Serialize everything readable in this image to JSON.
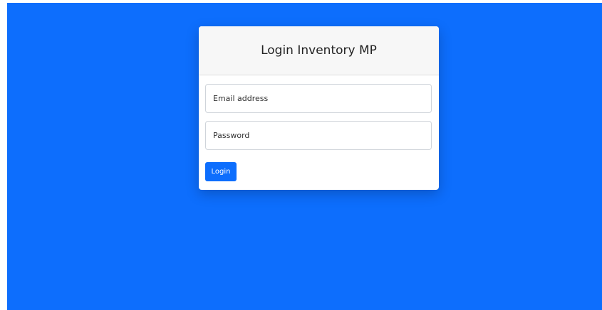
{
  "page": {
    "background_color": "#0d6efd"
  },
  "login_card": {
    "title": "Login Inventory MP",
    "email_field": {
      "placeholder": "Email address",
      "value": ""
    },
    "password_field": {
      "placeholder": "Password",
      "value": ""
    },
    "login_button_label": "Login",
    "accent_color": "#0d6efd"
  }
}
